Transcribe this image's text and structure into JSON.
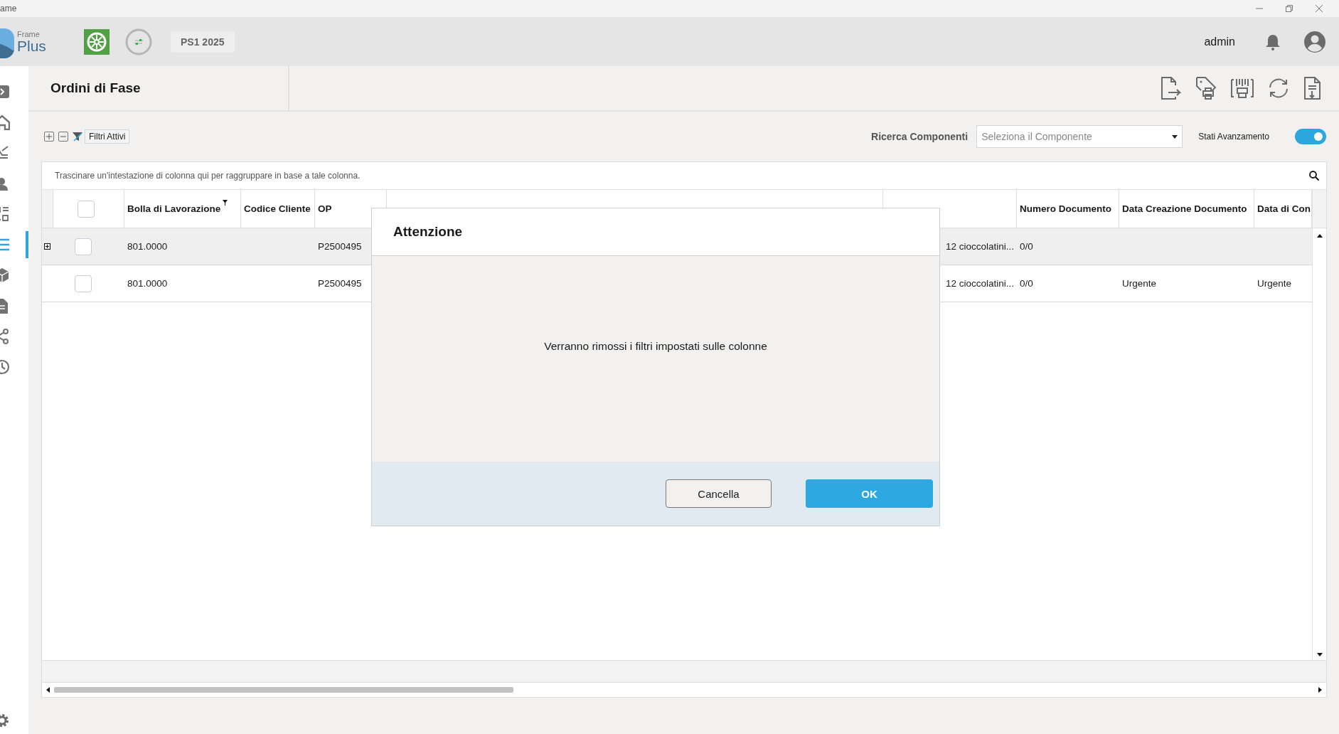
{
  "window": {
    "title": "ame"
  },
  "header": {
    "logo": {
      "line_1": "Frame",
      "line_2": "Plus"
    },
    "company_chip": "PS1 2025",
    "user": "admin"
  },
  "sidebar": {
    "items": [
      {
        "selected": false
      },
      {
        "selected": false
      },
      {
        "selected": false
      },
      {
        "selected": false
      },
      {
        "selected": false
      },
      {
        "selected": true
      },
      {
        "selected": false
      },
      {
        "selected": false
      },
      {
        "selected": false
      },
      {
        "selected": false
      }
    ]
  },
  "page": {
    "title": "Ordini di Fase"
  },
  "filter_bar": {
    "active_filters_button": "Filtri Attivi",
    "component_search": {
      "label": "Ricerca Componenti",
      "placeholder": "Seleziona il Componente"
    },
    "progress_states": {
      "label": "Stati Avanzamento",
      "on": true
    }
  },
  "table": {
    "group_panel": "Trascinare un'intestazione di colonna qui per raggruppare in base a tale colonna.",
    "all_checked": false,
    "columns": [
      {
        "label": "Bolla di Lavorazione",
        "filtered": true
      },
      {
        "label": "Codice Cliente",
        "filtered": false
      },
      {
        "label": "OP",
        "filtered": false
      },
      {
        "filtered": false
      },
      {
        "label": "Numero Documento",
        "filtered": false
      },
      {
        "label": "Data Creazione Documento",
        "filtered": false
      },
      {
        "label": "Data di Con",
        "filtered": false
      }
    ],
    "rows": [
      {
        "expandable": true,
        "selected": true,
        "checked": false,
        "cells": [
          "801.0000",
          null,
          "P2500495",
          "12 cioccolatini...",
          "0/0",
          null,
          null
        ]
      },
      {
        "expandable": false,
        "selected": false,
        "checked": false,
        "cells": [
          "801.0000",
          null,
          "P2500495",
          "12 cioccolatini...",
          "0/0",
          "Urgente",
          "Urgente"
        ]
      }
    ]
  },
  "dialog": {
    "title": "Attenzione",
    "message": "Verranno rimossi i filtri impostati sulle colonne",
    "buttons": [
      {
        "label": "Cancella",
        "kind": "secondary"
      },
      {
        "label": "OK",
        "kind": "primary"
      }
    ]
  }
}
